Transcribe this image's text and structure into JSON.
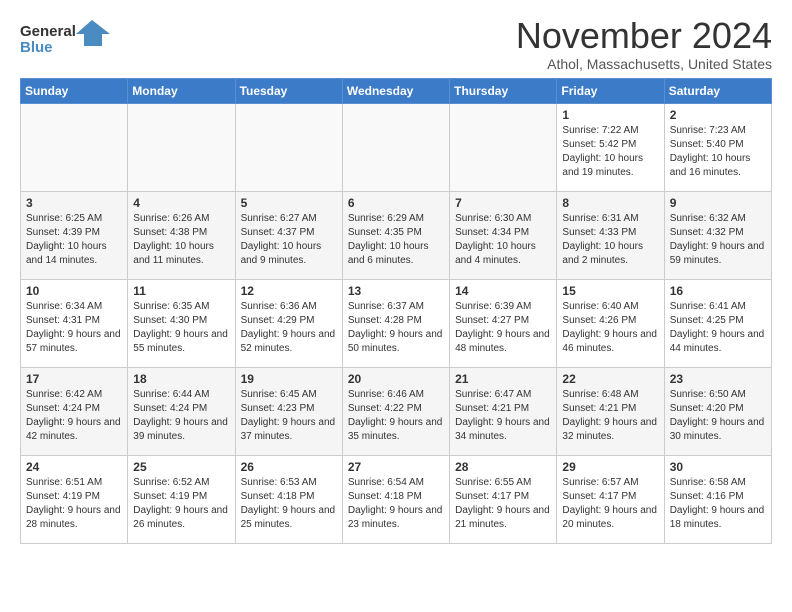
{
  "logo": {
    "line1": "General",
    "line2": "Blue",
    "icon_color": "#4a8cc2"
  },
  "title": "November 2024",
  "subtitle": "Athol, Massachusetts, United States",
  "headers": [
    "Sunday",
    "Monday",
    "Tuesday",
    "Wednesday",
    "Thursday",
    "Friday",
    "Saturday"
  ],
  "weeks": [
    [
      {
        "day": "",
        "info": ""
      },
      {
        "day": "",
        "info": ""
      },
      {
        "day": "",
        "info": ""
      },
      {
        "day": "",
        "info": ""
      },
      {
        "day": "",
        "info": ""
      },
      {
        "day": "1",
        "info": "Sunrise: 7:22 AM\nSunset: 5:42 PM\nDaylight: 10 hours and 19 minutes."
      },
      {
        "day": "2",
        "info": "Sunrise: 7:23 AM\nSunset: 5:40 PM\nDaylight: 10 hours and 16 minutes."
      }
    ],
    [
      {
        "day": "3",
        "info": "Sunrise: 6:25 AM\nSunset: 4:39 PM\nDaylight: 10 hours and 14 minutes."
      },
      {
        "day": "4",
        "info": "Sunrise: 6:26 AM\nSunset: 4:38 PM\nDaylight: 10 hours and 11 minutes."
      },
      {
        "day": "5",
        "info": "Sunrise: 6:27 AM\nSunset: 4:37 PM\nDaylight: 10 hours and 9 minutes."
      },
      {
        "day": "6",
        "info": "Sunrise: 6:29 AM\nSunset: 4:35 PM\nDaylight: 10 hours and 6 minutes."
      },
      {
        "day": "7",
        "info": "Sunrise: 6:30 AM\nSunset: 4:34 PM\nDaylight: 10 hours and 4 minutes."
      },
      {
        "day": "8",
        "info": "Sunrise: 6:31 AM\nSunset: 4:33 PM\nDaylight: 10 hours and 2 minutes."
      },
      {
        "day": "9",
        "info": "Sunrise: 6:32 AM\nSunset: 4:32 PM\nDaylight: 9 hours and 59 minutes."
      }
    ],
    [
      {
        "day": "10",
        "info": "Sunrise: 6:34 AM\nSunset: 4:31 PM\nDaylight: 9 hours and 57 minutes."
      },
      {
        "day": "11",
        "info": "Sunrise: 6:35 AM\nSunset: 4:30 PM\nDaylight: 9 hours and 55 minutes."
      },
      {
        "day": "12",
        "info": "Sunrise: 6:36 AM\nSunset: 4:29 PM\nDaylight: 9 hours and 52 minutes."
      },
      {
        "day": "13",
        "info": "Sunrise: 6:37 AM\nSunset: 4:28 PM\nDaylight: 9 hours and 50 minutes."
      },
      {
        "day": "14",
        "info": "Sunrise: 6:39 AM\nSunset: 4:27 PM\nDaylight: 9 hours and 48 minutes."
      },
      {
        "day": "15",
        "info": "Sunrise: 6:40 AM\nSunset: 4:26 PM\nDaylight: 9 hours and 46 minutes."
      },
      {
        "day": "16",
        "info": "Sunrise: 6:41 AM\nSunset: 4:25 PM\nDaylight: 9 hours and 44 minutes."
      }
    ],
    [
      {
        "day": "17",
        "info": "Sunrise: 6:42 AM\nSunset: 4:24 PM\nDaylight: 9 hours and 42 minutes."
      },
      {
        "day": "18",
        "info": "Sunrise: 6:44 AM\nSunset: 4:24 PM\nDaylight: 9 hours and 39 minutes."
      },
      {
        "day": "19",
        "info": "Sunrise: 6:45 AM\nSunset: 4:23 PM\nDaylight: 9 hours and 37 minutes."
      },
      {
        "day": "20",
        "info": "Sunrise: 6:46 AM\nSunset: 4:22 PM\nDaylight: 9 hours and 35 minutes."
      },
      {
        "day": "21",
        "info": "Sunrise: 6:47 AM\nSunset: 4:21 PM\nDaylight: 9 hours and 34 minutes."
      },
      {
        "day": "22",
        "info": "Sunrise: 6:48 AM\nSunset: 4:21 PM\nDaylight: 9 hours and 32 minutes."
      },
      {
        "day": "23",
        "info": "Sunrise: 6:50 AM\nSunset: 4:20 PM\nDaylight: 9 hours and 30 minutes."
      }
    ],
    [
      {
        "day": "24",
        "info": "Sunrise: 6:51 AM\nSunset: 4:19 PM\nDaylight: 9 hours and 28 minutes."
      },
      {
        "day": "25",
        "info": "Sunrise: 6:52 AM\nSunset: 4:19 PM\nDaylight: 9 hours and 26 minutes."
      },
      {
        "day": "26",
        "info": "Sunrise: 6:53 AM\nSunset: 4:18 PM\nDaylight: 9 hours and 25 minutes."
      },
      {
        "day": "27",
        "info": "Sunrise: 6:54 AM\nSunset: 4:18 PM\nDaylight: 9 hours and 23 minutes."
      },
      {
        "day": "28",
        "info": "Sunrise: 6:55 AM\nSunset: 4:17 PM\nDaylight: 9 hours and 21 minutes."
      },
      {
        "day": "29",
        "info": "Sunrise: 6:57 AM\nSunset: 4:17 PM\nDaylight: 9 hours and 20 minutes."
      },
      {
        "day": "30",
        "info": "Sunrise: 6:58 AM\nSunset: 4:16 PM\nDaylight: 9 hours and 18 minutes."
      }
    ]
  ]
}
